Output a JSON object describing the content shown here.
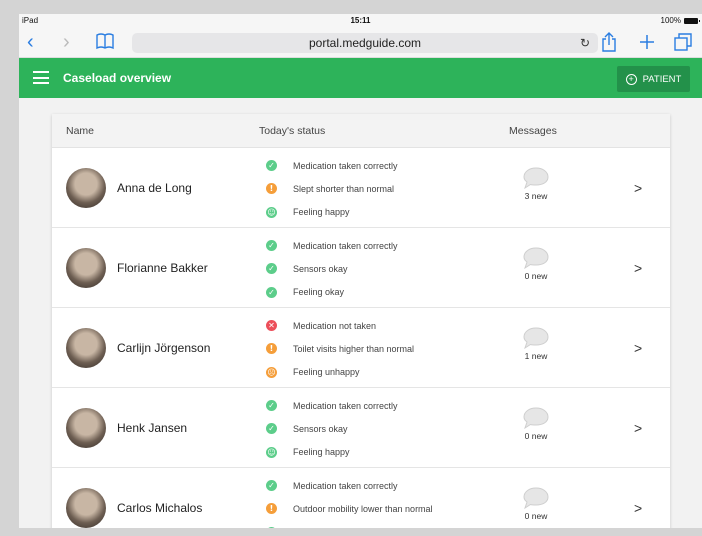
{
  "statusbar": {
    "device": "iPad",
    "time": "15:11",
    "battery": "100%"
  },
  "browser": {
    "url": "portal.medguide.com"
  },
  "appbar": {
    "title": "Caseload overview",
    "add_button": "PATIENT"
  },
  "table": {
    "headers": {
      "name": "Name",
      "status": "Today's status",
      "messages": "Messages"
    },
    "rows": [
      {
        "name": "Anna de Long",
        "status": [
          {
            "icon": "check",
            "color": "green",
            "text": "Medication taken correctly"
          },
          {
            "icon": "exclamation",
            "color": "orange",
            "text": "Slept shorter than normal"
          },
          {
            "icon": "smiley-happy",
            "color": "green",
            "text": "Feeling happy"
          }
        ],
        "messages": "3 new"
      },
      {
        "name": "Florianne Bakker",
        "status": [
          {
            "icon": "check",
            "color": "green",
            "text": "Medication taken correctly"
          },
          {
            "icon": "check",
            "color": "green",
            "text": "Sensors okay"
          },
          {
            "icon": "check",
            "color": "green",
            "text": "Feeling okay"
          }
        ],
        "messages": "0 new"
      },
      {
        "name": "Carlijn Jörgenson",
        "status": [
          {
            "icon": "cross",
            "color": "red",
            "text": "Medication not taken"
          },
          {
            "icon": "exclamation",
            "color": "orange",
            "text": "Toilet visits higher than normal"
          },
          {
            "icon": "smiley-unhappy",
            "color": "orange",
            "text": "Feeling unhappy"
          }
        ],
        "messages": "1 new"
      },
      {
        "name": "Henk Jansen",
        "status": [
          {
            "icon": "check",
            "color": "green",
            "text": "Medication taken correctly"
          },
          {
            "icon": "check",
            "color": "green",
            "text": "Sensors okay"
          },
          {
            "icon": "smiley-happy",
            "color": "green",
            "text": "Feeling happy"
          }
        ],
        "messages": "0 new"
      },
      {
        "name": "Carlos Michalos",
        "status": [
          {
            "icon": "check",
            "color": "green",
            "text": "Medication taken correctly"
          },
          {
            "icon": "exclamation",
            "color": "orange",
            "text": "Outdoor mobility lower than normal"
          },
          {
            "icon": "check",
            "color": "green",
            "text": ""
          }
        ],
        "messages": "0 new"
      }
    ]
  },
  "colors": {
    "appbar": "#2db35a",
    "button": "#23914a",
    "green": "#5ccd8a",
    "orange": "#f59e3a",
    "red": "#ec4f5a"
  }
}
